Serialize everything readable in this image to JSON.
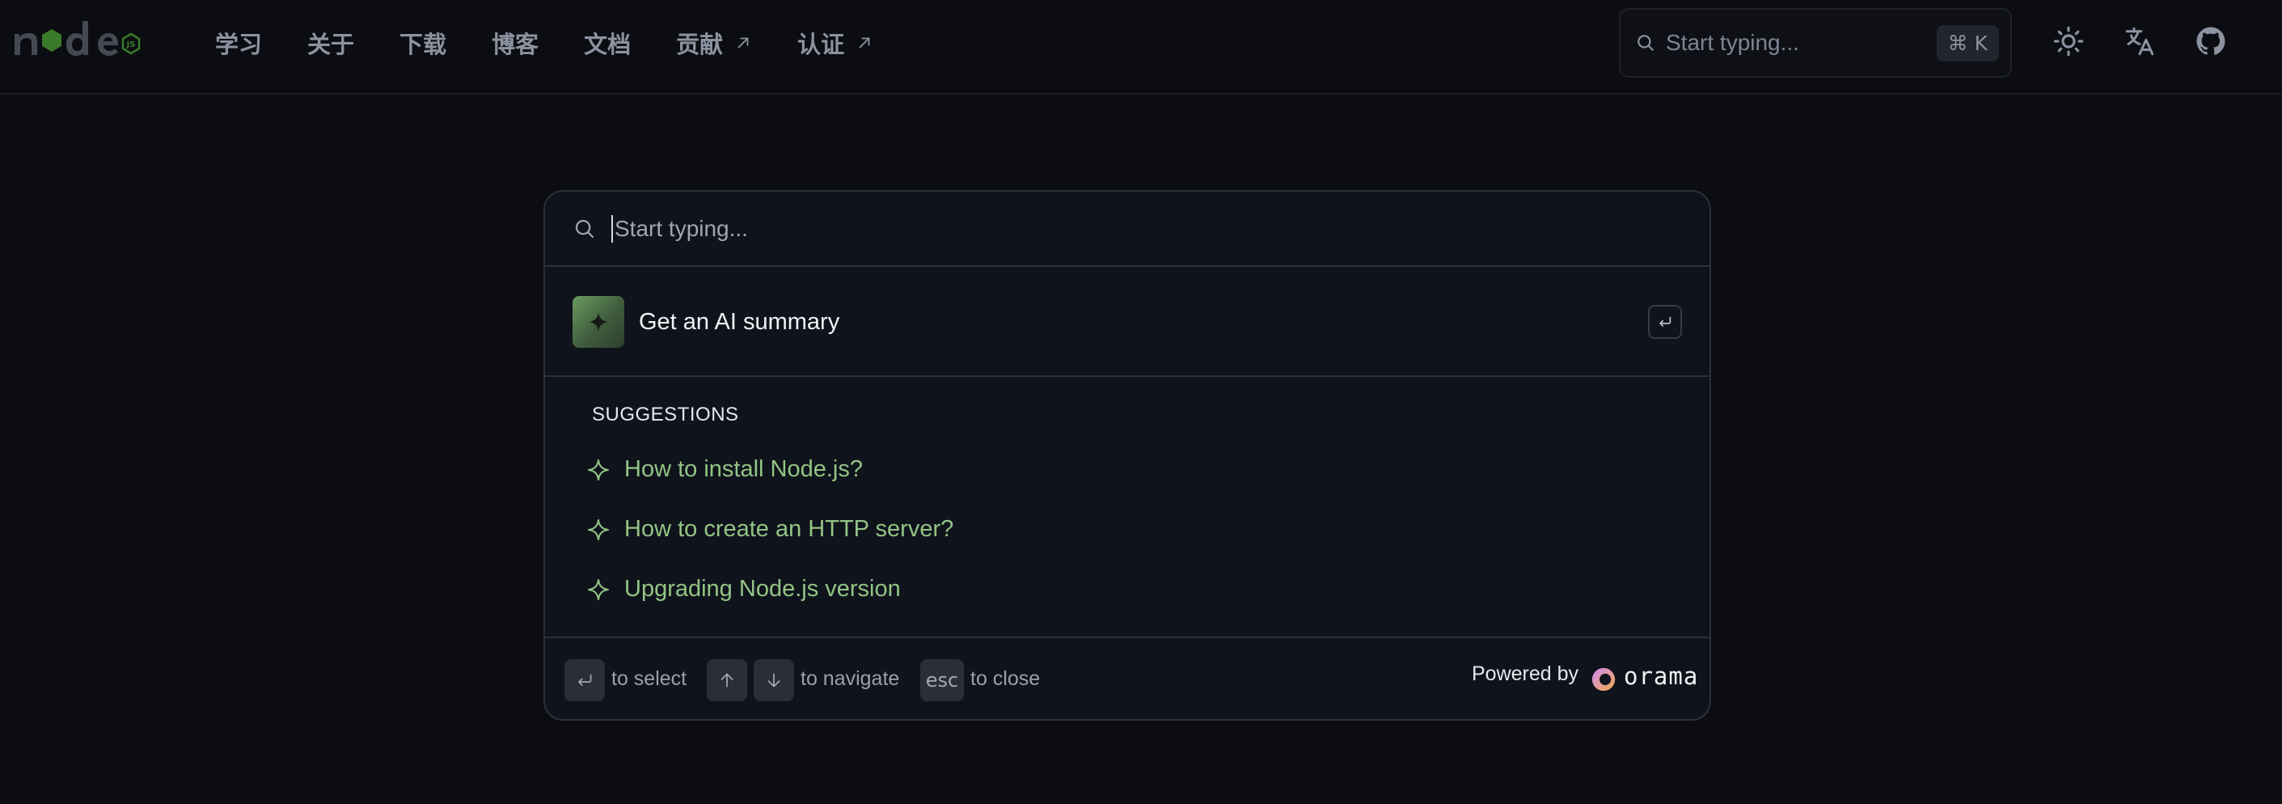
{
  "nav": {
    "items": [
      {
        "label": "学习"
      },
      {
        "label": "关于"
      },
      {
        "label": "下载"
      },
      {
        "label": "博客"
      },
      {
        "label": "文档"
      },
      {
        "label": "贡献",
        "external": true
      },
      {
        "label": "认证",
        "external": true
      }
    ],
    "search_placeholder": "Start typing...",
    "search_shortcut": "⌘ K",
    "icons": [
      "theme-toggle-icon",
      "language-icon",
      "github-icon"
    ]
  },
  "modal": {
    "search_placeholder": "Start typing...",
    "ai_label": "Get an AI summary",
    "suggestions_title": "SUGGESTIONS",
    "suggestions": [
      "How to install Node.js?",
      "How to create an HTTP server?",
      "Upgrading Node.js version"
    ],
    "footer": {
      "select_hint": "to select",
      "navigate_hint": "to navigate",
      "esc_key": "esc",
      "close_hint": "to close",
      "powered_by": "Powered by",
      "brand": "orama"
    }
  },
  "colors": {
    "background": "#0b0d12",
    "modal_bg": "#0f131c",
    "suggestion_green": "#93c484",
    "accent_green": "#6b9a5f"
  }
}
